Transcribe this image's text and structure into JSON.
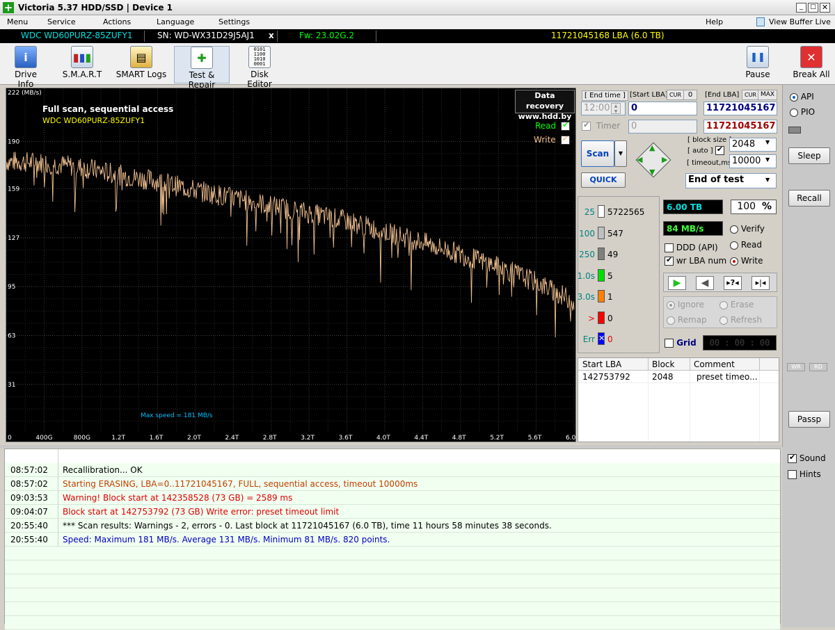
{
  "window": {
    "title": "Victoria 5.37 HDD/SSD | Device 1"
  },
  "menu": {
    "items": [
      "Menu",
      "Service",
      "Actions",
      "Language",
      "Settings"
    ],
    "help": "Help",
    "view_buffer": "View Buffer Live"
  },
  "device": {
    "model": "WDC WD60PURZ-85ZUFY1",
    "serial": "SN: WD-WX31D29J5AJ1",
    "close": "x",
    "firmware": "Fw: 23.02G.2",
    "lba": "11721045168 LBA (6.0 TB)"
  },
  "toolbar": {
    "drive_info": "Drive Info",
    "smart": "S.M.A.R.T",
    "smart_logs": "SMART Logs",
    "test_repair": "Test & Repair",
    "disk_editor": "Disk Editor",
    "pause": "Pause",
    "break_all": "Break All"
  },
  "graph": {
    "unit": "222 (MB/s)",
    "title": "Full scan, sequential access",
    "subtitle": "WDC WD60PURZ-85ZUFY1",
    "badge_line1": "Data recovery",
    "badge_line2": "www.hdd.by",
    "legend_read": "Read",
    "legend_write": "Write",
    "max_speed": "Max speed = 181 MB/s",
    "y_ticks": [
      "190",
      "159",
      "127",
      "95",
      "63",
      "31"
    ],
    "x_ticks": [
      "0",
      "400G",
      "800G",
      "1.2T",
      "1.6T",
      "2.0T",
      "2.4T",
      "2.8T",
      "3.2T",
      "3.6T",
      "4.0T",
      "4.4T",
      "4.8T",
      "5.2T",
      "5.6T",
      "6.0T"
    ],
    "colors": {
      "write": "#f0c090",
      "grid": "#555555",
      "title": "#ffffff",
      "subtitle": "#ffff00",
      "max_speed": "#00c0ff"
    }
  },
  "chart_data": {
    "type": "line",
    "title": "Full scan, sequential access",
    "xlabel": "",
    "ylabel": "MB/s",
    "ylim": [
      0,
      222
    ],
    "xlim_tb": [
      0,
      6.0
    ],
    "series": [
      {
        "name": "Write",
        "x_tb": [
          0,
          0.4,
          0.8,
          1.2,
          1.6,
          2.0,
          2.4,
          2.8,
          3.2,
          3.6,
          4.0,
          4.4,
          4.8,
          5.2,
          5.6,
          6.0
        ],
        "values": [
          177,
          176,
          173,
          168,
          164,
          158,
          153,
          148,
          143,
          138,
          131,
          124,
          116,
          108,
          98,
          85
        ]
      }
    ]
  },
  "controls": {
    "end_time_label": "[ End time ]",
    "start_lba_label": "[Start LBA]",
    "cur": "CUR",
    "zero": "0",
    "end_lba_label": "[End LBA]",
    "max": "MAX",
    "end_time_value": "12:00",
    "start_lba_value": "0",
    "end_lba_value": "11721045167",
    "timer_label": "Timer",
    "timer_value": "0",
    "end_lba_value2": "11721045167",
    "scan": "Scan",
    "quick": "QUICK",
    "block_size_label": "[ block size ]",
    "auto_label": "[ auto ]",
    "block_size_value": "2048",
    "timeout_label": "[ timeout,ms ]",
    "timeout_value": "10000",
    "end_action": "End of test"
  },
  "histogram": [
    {
      "label": "25",
      "count": "5722565",
      "color": "#ffffff",
      "label_color": "#008080"
    },
    {
      "label": "100",
      "count": "547",
      "color": "#c0c0c0",
      "label_color": "#008080"
    },
    {
      "label": "250",
      "count": "49",
      "color": "#808080",
      "label_color": "#008080"
    },
    {
      "label": "1.0s",
      "count": "5",
      "color": "#00e000",
      "label_color": "#008080"
    },
    {
      "label": "3.0s",
      "count": "1",
      "color": "#ff8000",
      "label_color": "#008080"
    },
    {
      "label": ">",
      "count": "0",
      "color": "#ff0000",
      "label_color": "#ff0000"
    },
    {
      "label": "Err",
      "count": "0",
      "color": "#0000ff",
      "label_color": "#008080"
    }
  ],
  "stats": {
    "size": "6.00 TB",
    "percent": "100",
    "percent_sign": "%",
    "speed": "84 MB/s"
  },
  "options": {
    "ddd": "DDD (API)",
    "wr_lba": "wr LBA num",
    "verify": "Verify",
    "read": "Read",
    "write": "Write",
    "ignore": "Ignore",
    "erase": "Erase",
    "remap": "Remap",
    "refresh": "Refresh",
    "grid": "Grid",
    "timer_display": "00 : 00 : 00"
  },
  "defects": {
    "headers": [
      "Start LBA",
      "Block",
      "Comment"
    ],
    "rows": [
      [
        "142753792",
        "2048",
        "preset timeo..."
      ]
    ]
  },
  "side": {
    "api": "API",
    "pio": "PIO",
    "sleep": "Sleep",
    "recall": "Recall",
    "wr": "WR",
    "rd": "RD",
    "passp": "Passp",
    "sound": "Sound",
    "hints": "Hints"
  },
  "log": [
    {
      "time": "08:57:02",
      "msg": "Recallibration... OK",
      "color": "#000000"
    },
    {
      "time": "08:57:02",
      "msg": "Starting ERASING, LBA=0..11721045167, FULL, sequential access, timeout 10000ms",
      "color": "#c04000"
    },
    {
      "time": "09:03:53",
      "msg": "Warning! Block start at 142358528 (73 GB)  = 2589 ms",
      "color": "#e00000"
    },
    {
      "time": "09:04:07",
      "msg": "Block start at 142753792 (73 GB) Write error: preset timeout limit",
      "color": "#e00000"
    },
    {
      "time": "20:55:40",
      "msg": "*** Scan results: Warnings - 2, errors - 0. Last block at 11721045167 (6.0 TB), time 11 hours 58 minutes 38 seconds.",
      "color": "#000000"
    },
    {
      "time": "20:55:40",
      "msg": "Speed: Maximum 181 MB/s. Average 131 MB/s. Minimum 81 MB/s. 820 points.",
      "color": "#0000c0"
    }
  ]
}
